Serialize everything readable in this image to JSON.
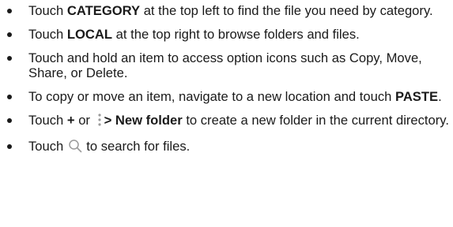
{
  "items": [
    {
      "pre": "Touch ",
      "bold": "CATEGORY",
      "post": " at the top left to find the file you need by category."
    },
    {
      "pre": "Touch ",
      "bold": "LOCAL",
      "post": " at the top right to browse folders and files."
    },
    {
      "text": "Touch and hold an item to access option icons such as Copy, Move, Share, or Delete."
    },
    {
      "pre": "To copy or move an item, navigate to a new location and touch ",
      "bold": "PASTE",
      "post": "."
    },
    {
      "pre": "Touch ",
      "plus": "+",
      "mid": " or ",
      "bold": "> New folder",
      "post": " to create a new folder in the current directory."
    },
    {
      "pre": "Touch",
      "post": "to search for files."
    }
  ],
  "icons": {
    "menu": "more-vertical-icon",
    "search": "search-icon"
  }
}
